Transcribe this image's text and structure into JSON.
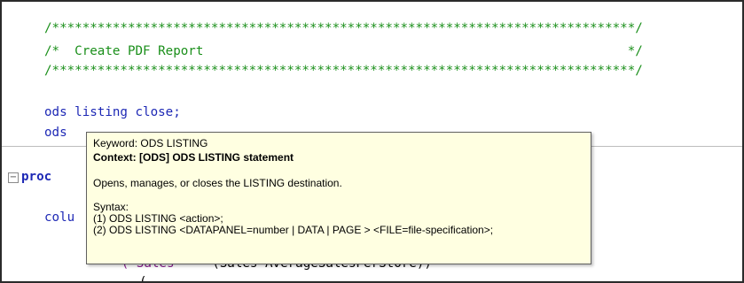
{
  "editor": {
    "lines": {
      "banner_top": "/*****************************************************************************/",
      "banner_mid": "/*  Create PDF Report                                                        */",
      "banner_bottom": "/*****************************************************************************/",
      "ods_close_kw": "ods",
      "ods_close_rest": " listing close;",
      "ods_partial": "ods",
      "proc_partial": "proc",
      "columns_partial": "colu",
      "sales_indent": "     ",
      "sales_str": "(\"Sales\"",
      "sales_rest": "    (Sales AverageSalesPerStore))",
      "paren_partial": "("
    },
    "fold_symbol": "−"
  },
  "tooltip": {
    "keyword": "Keyword: ODS LISTING",
    "context": "Context: [ODS] ODS LISTING statement",
    "description": "Opens, manages, or closes the LISTING destination.",
    "syntax_label": "Syntax:",
    "syntax_1": "(1) ODS LISTING <action>;",
    "syntax_2": "(2) ODS LISTING <DATAPANEL=number | DATA | PAGE > <FILE=file-specification>;"
  }
}
